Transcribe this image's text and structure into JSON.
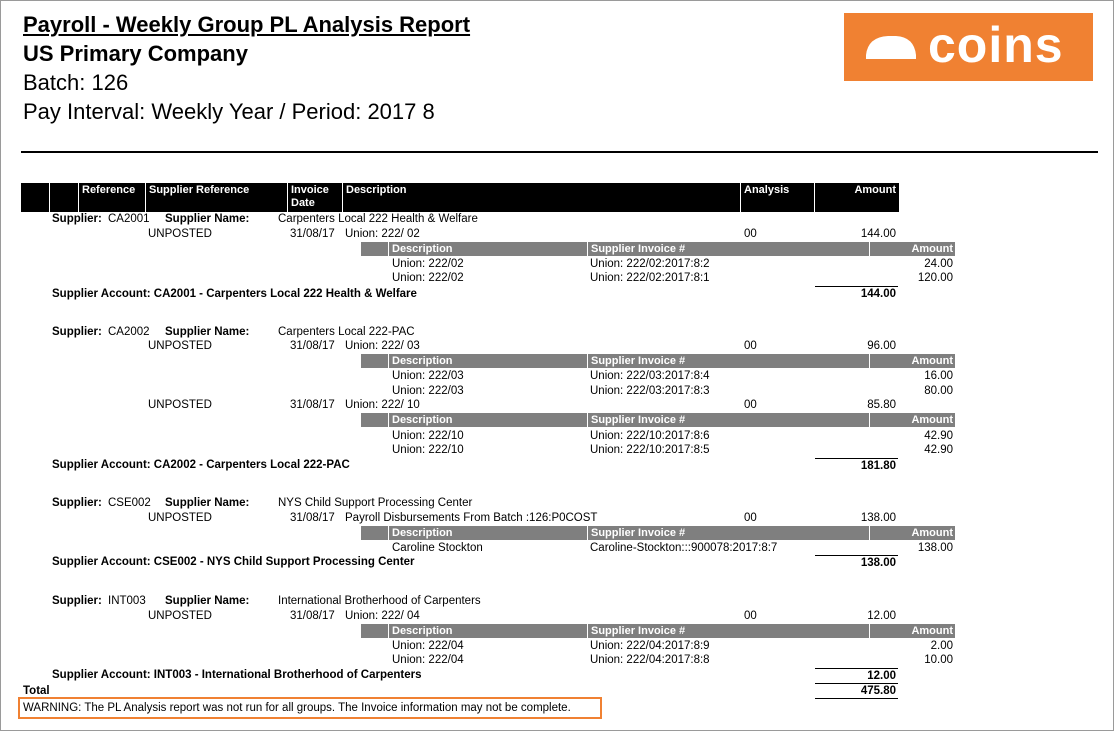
{
  "header": {
    "title": "Payroll - Weekly Group PL Analysis Report",
    "company": "US Primary Company",
    "batch": "Batch: 126",
    "interval": "Pay Interval: Weekly Year / Period: 2017 8",
    "logo_text": "coins",
    "logo_color": "#f08132"
  },
  "table": {
    "columns": [
      "Reference",
      "Supplier Reference",
      "Invoice Date",
      "Description",
      "Analysis",
      "Amount"
    ],
    "sub_columns": [
      "Description",
      "Supplier Invoice #",
      "Amount"
    ]
  },
  "labels": {
    "supplier": "Supplier:",
    "supplier_name": "Supplier Name:",
    "total": "Total"
  },
  "groups": [
    {
      "code": "CA2001",
      "name": "Carpenters Local 222 Health & Welfare",
      "invoices": [
        {
          "status": "UNPOSTED",
          "date": "31/08/17",
          "description": "Union: 222/ 02",
          "analysis": "00",
          "amount": "144.00",
          "lines": [
            {
              "description": "Union: 222/02",
              "invoice": "Union: 222/02:2017:8:2",
              "amount": "24.00"
            },
            {
              "description": "Union: 222/02",
              "invoice": "Union: 222/02:2017:8:1",
              "amount": "120.00"
            }
          ]
        }
      ],
      "account_label": "Supplier Account: CA2001 - Carpenters Local 222 Health & Welfare",
      "account_total": "144.00"
    },
    {
      "code": "CA2002",
      "name": "Carpenters Local 222-PAC",
      "invoices": [
        {
          "status": "UNPOSTED",
          "date": "31/08/17",
          "description": "Union: 222/ 03",
          "analysis": "00",
          "amount": "96.00",
          "lines": [
            {
              "description": "Union: 222/03",
              "invoice": "Union: 222/03:2017:8:4",
              "amount": "16.00"
            },
            {
              "description": "Union: 222/03",
              "invoice": "Union: 222/03:2017:8:3",
              "amount": "80.00"
            }
          ]
        },
        {
          "status": "UNPOSTED",
          "date": "31/08/17",
          "description": "Union: 222/ 10",
          "analysis": "00",
          "amount": "85.80",
          "lines": [
            {
              "description": "Union: 222/10",
              "invoice": "Union: 222/10:2017:8:6",
              "amount": "42.90"
            },
            {
              "description": "Union: 222/10",
              "invoice": "Union: 222/10:2017:8:5",
              "amount": "42.90"
            }
          ]
        }
      ],
      "account_label": "Supplier Account: CA2002 - Carpenters Local 222-PAC",
      "account_total": "181.80"
    },
    {
      "code": "CSE002",
      "name": "NYS Child Support Processing Center",
      "invoices": [
        {
          "status": "UNPOSTED",
          "date": "31/08/17",
          "description": "Payroll Disbursements From Batch :126:P0COST",
          "analysis": "00",
          "amount": "138.00",
          "lines": [
            {
              "description": "Caroline Stockton",
              "invoice": "Caroline-Stockton:::900078:2017:8:7",
              "amount": "138.00"
            }
          ]
        }
      ],
      "account_label": "Supplier Account: CSE002 - NYS Child Support Processing Center",
      "account_total": "138.00"
    },
    {
      "code": "INT003",
      "name": "International Brotherhood of Carpenters",
      "invoices": [
        {
          "status": "UNPOSTED",
          "date": "31/08/17",
          "description": "Union: 222/ 04",
          "analysis": "00",
          "amount": "12.00",
          "lines": [
            {
              "description": "Union: 222/04",
              "invoice": "Union: 222/04:2017:8:9",
              "amount": "2.00"
            },
            {
              "description": "Union: 222/04",
              "invoice": "Union: 222/04:2017:8:8",
              "amount": "10.00"
            }
          ]
        }
      ],
      "account_label": "Supplier Account: INT003 - International Brotherhood of Carpenters",
      "account_total": "12.00"
    }
  ],
  "grand_total": "475.80",
  "warning": "WARNING: The PL Analysis report was not run for all groups. The Invoice information may not be complete."
}
